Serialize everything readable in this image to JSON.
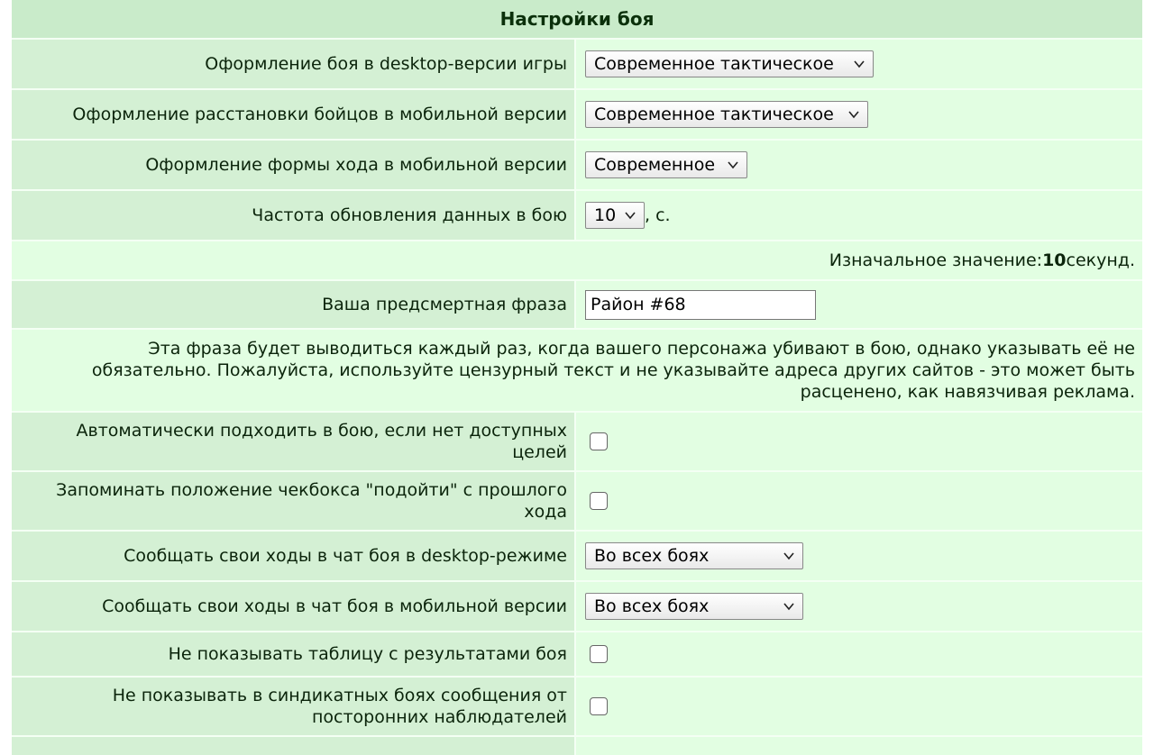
{
  "title": "Настройки боя",
  "rows": {
    "desktop_style": {
      "label": "Оформление боя в desktop-версии игры",
      "value": "Современное тактическое"
    },
    "mobile_arrange": {
      "label": "Оформление расстановки бойцов в мобильной версии",
      "value": "Современное тактическое"
    },
    "mobile_move_form": {
      "label": "Оформление формы хода в мобильной версии",
      "value": "Современное"
    },
    "refresh_rate": {
      "label": "Частота обновления данных в бою",
      "value": "10",
      "suffix": ", с."
    },
    "death_phrase": {
      "label": "Ваша предсмертная фраза",
      "value": "Район #68"
    },
    "auto_approach": {
      "label_line1": "Автоматически подходить в бою, если нет доступных",
      "label_line2": "целей",
      "checked": false
    },
    "remember_approach": {
      "label_line1": "Запоминать положение чекбокса \"подойти\" с прошлого",
      "label_line2": "хода",
      "checked": false
    },
    "chat_desktop": {
      "label": "Сообщать свои ходы в чат боя в desktop-режиме",
      "value": "Во всех боях"
    },
    "chat_mobile": {
      "label": "Сообщать свои ходы в чат боя в мобильной версии",
      "value": "Во всех боях"
    },
    "hide_results": {
      "label": "Не показывать таблицу с результатами боя",
      "checked": false
    },
    "hide_observers": {
      "label_line1": "Не показывать в синдикатных боях сообщения от",
      "label_line2": "посторонних наблюдателей",
      "checked": false
    }
  },
  "refresh_note": {
    "prefix": "Изначальное значение: ",
    "value": "10",
    "suffix": " секунд."
  },
  "phrase_note": {
    "line1": "Эта фраза будет выводиться каждый раз, когда вашего персонажа убивают в бою, однако указывать её не",
    "line2": "обязательно. Пожалуйста, используйте цензурный текст и не указывайте адреса других сайтов - это может быть",
    "line3": "расценено, как навязчивая реклама."
  },
  "icons": {
    "dropdown": "chevron-down-icon",
    "checkbox": "checkbox-icon"
  }
}
